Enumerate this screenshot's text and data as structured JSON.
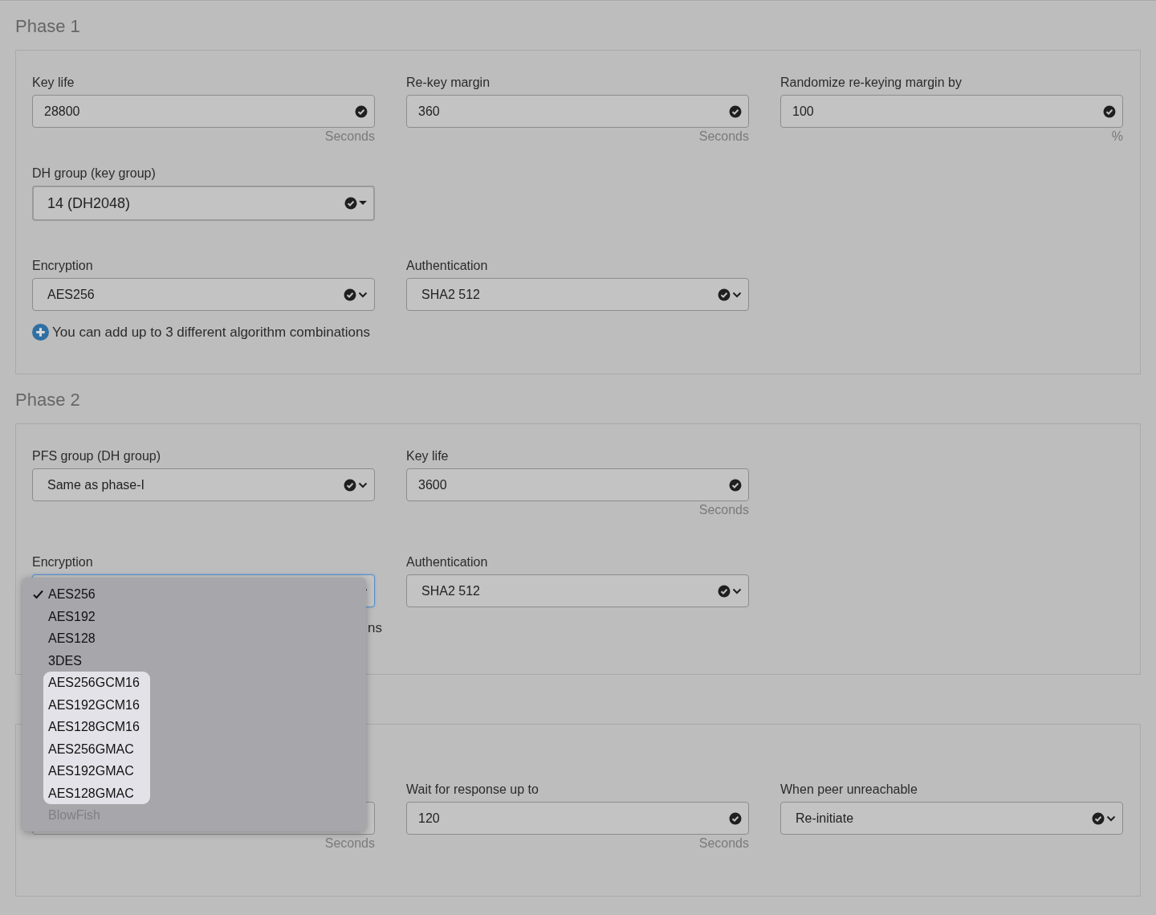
{
  "sections": [
    {
      "title": "Phase 1",
      "rows": [
        {
          "fields": [
            {
              "label": "Key life",
              "kind": "text",
              "value": "28800",
              "valid": true,
              "suffix": "Seconds"
            },
            {
              "label": "Re-key margin",
              "kind": "text",
              "value": "360",
              "valid": true,
              "suffix": "Seconds"
            },
            {
              "label": "Randomize re-keying margin by",
              "kind": "text",
              "value": "100",
              "valid": true,
              "suffix": "%"
            }
          ]
        },
        {
          "fields": [
            {
              "label": "DH group (key group)",
              "kind": "caret",
              "value": "14 (DH2048)",
              "valid": true
            }
          ]
        },
        {
          "fields": [
            {
              "label": "Encryption",
              "kind": "select",
              "value": "AES256",
              "valid": true
            },
            {
              "label": "Authentication",
              "kind": "select",
              "value": "SHA2 512",
              "valid": true
            }
          ]
        }
      ],
      "hint": {
        "text": "You can add up to 3 different algorithm combinations",
        "kind": "add"
      }
    },
    {
      "title": "Phase 2",
      "rows": [
        {
          "fields": [
            {
              "label": "PFS group (DH group)",
              "kind": "select",
              "value": "Same as phase-I",
              "valid": true
            },
            {
              "label": "Key life",
              "kind": "text",
              "value": "3600",
              "valid": true,
              "suffix": "Seconds"
            }
          ]
        },
        {
          "fields": [
            {
              "label": "Encryption",
              "kind": "select",
              "focused": true
            },
            {
              "label": "Authentication",
              "kind": "select",
              "value": "SHA2 512",
              "valid": true
            }
          ]
        }
      ],
      "hint": {
        "text": "ns",
        "kind": "tail"
      }
    },
    {
      "rows": [
        {
          "fields": [
            {
              "kind": "text",
              "suffix": "Seconds"
            },
            {
              "label": "Wait for response up to",
              "kind": "text",
              "value": "120",
              "valid": true,
              "suffix": "Seconds"
            },
            {
              "label": "When peer unreachable",
              "kind": "select",
              "value": "Re-initiate",
              "valid": true
            }
          ]
        }
      ]
    }
  ],
  "dropdown": {
    "options": [
      {
        "label": "AES256",
        "selected": true,
        "highlighted": false,
        "disabled": false
      },
      {
        "label": "AES192",
        "selected": false,
        "highlighted": false,
        "disabled": false
      },
      {
        "label": "AES128",
        "selected": false,
        "highlighted": false,
        "disabled": false
      },
      {
        "label": "3DES",
        "selected": false,
        "highlighted": false,
        "disabled": false
      },
      {
        "label": "AES256GCM16",
        "selected": false,
        "highlighted": true,
        "disabled": false
      },
      {
        "label": "AES192GCM16",
        "selected": false,
        "highlighted": true,
        "disabled": false
      },
      {
        "label": "AES128GCM16",
        "selected": false,
        "highlighted": true,
        "disabled": false
      },
      {
        "label": "AES256GMAC",
        "selected": false,
        "highlighted": true,
        "disabled": false
      },
      {
        "label": "AES192GMAC",
        "selected": false,
        "highlighted": true,
        "disabled": false
      },
      {
        "label": "AES128GMAC",
        "selected": false,
        "highlighted": true,
        "disabled": false
      },
      {
        "label": "BlowFish",
        "selected": false,
        "highlighted": false,
        "disabled": true
      }
    ]
  }
}
